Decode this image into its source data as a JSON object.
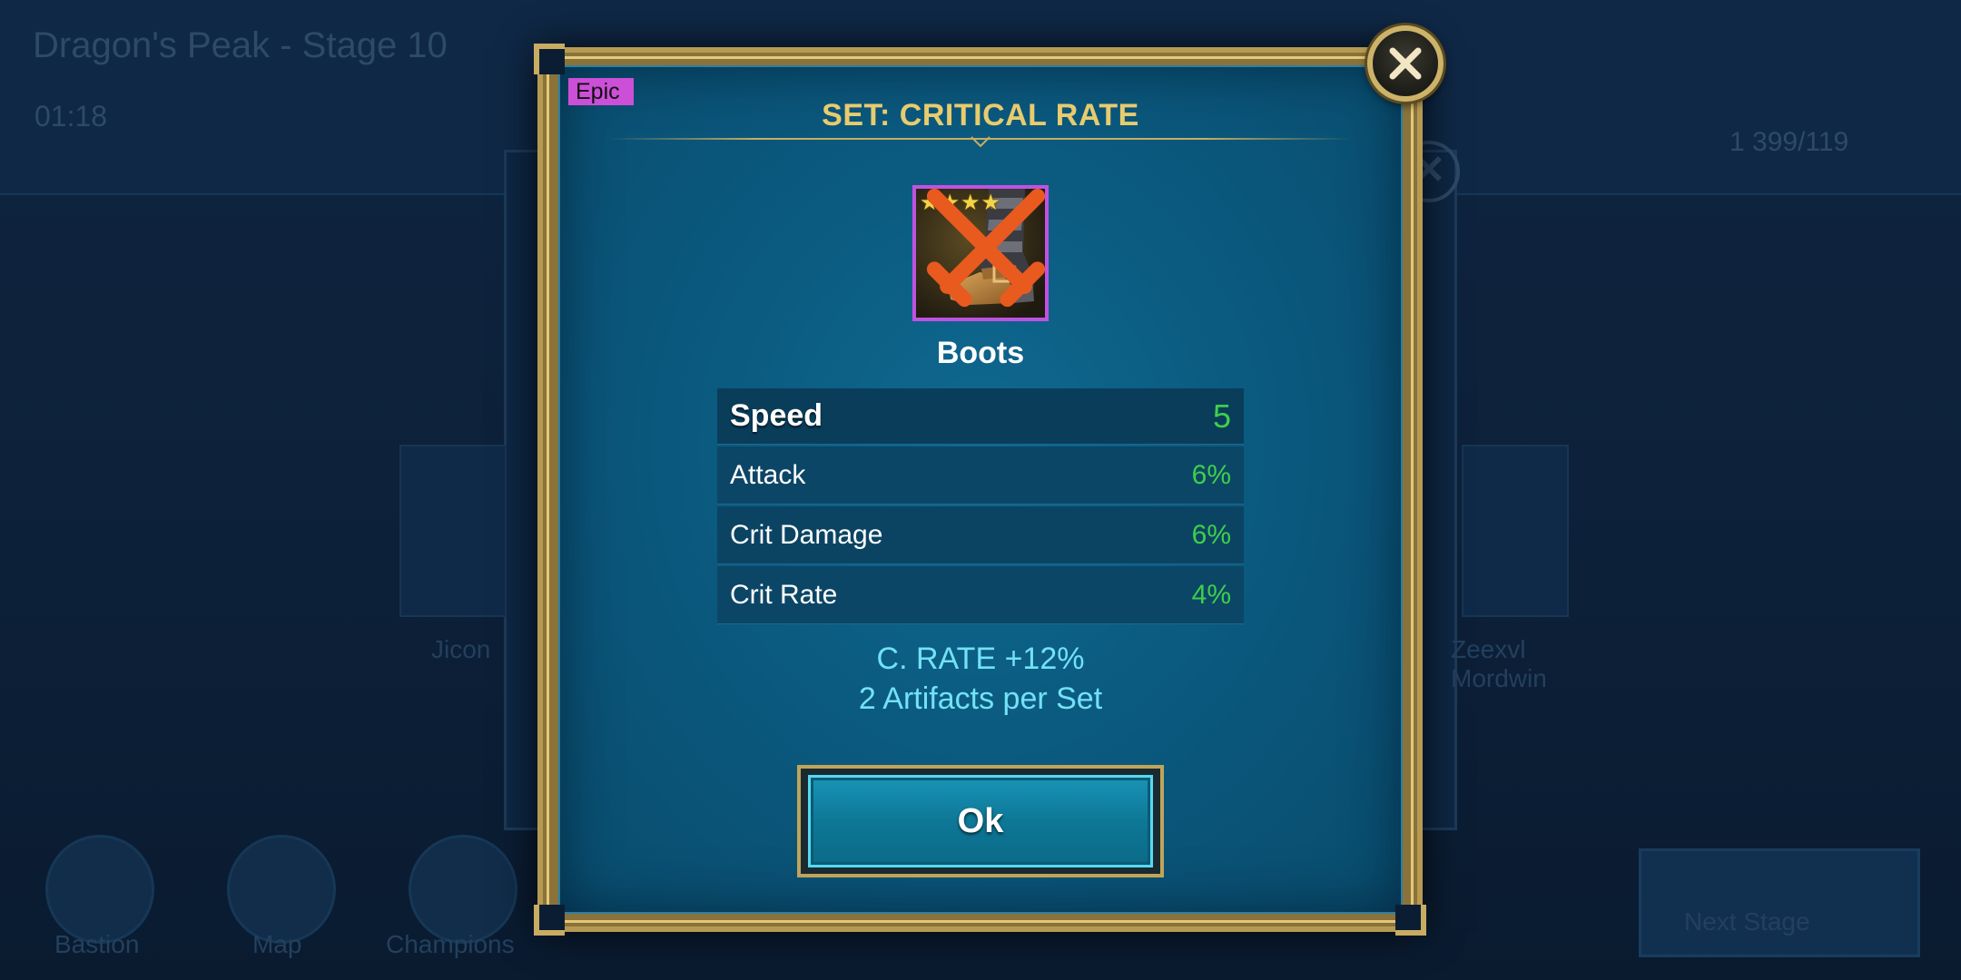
{
  "background": {
    "title": "Dragon's Peak - Stage 10",
    "timer": "01:18",
    "energy": "1 399/119",
    "slot_names": [
      "Jicon",
      "Zeexvl Mordwin"
    ],
    "nav": [
      {
        "label": "Bastion",
        "icon": "castle-icon"
      },
      {
        "label": "Map",
        "icon": "compass-icon"
      },
      {
        "label": "Champions",
        "icon": "helmet-icon"
      }
    ],
    "next_button_label": "Next Stage"
  },
  "modal": {
    "rarity": "Epic",
    "title": "SET: CRITICAL RATE",
    "item": {
      "name": "Boots",
      "stars": 4,
      "icon": "boots-icon",
      "faction_icon": "crossed-swords-icon"
    },
    "main_stat": {
      "label": "Speed",
      "value": "5"
    },
    "substats": [
      {
        "label": "Attack",
        "value": "6%"
      },
      {
        "label": "Crit Damage",
        "value": "6%"
      },
      {
        "label": "Crit Rate",
        "value": "4%"
      }
    ],
    "set_bonus": "C. RATE +12%",
    "set_requirement": "2 Artifacts per Set",
    "ok_label": "Ok",
    "colors": {
      "title": "#e8cb6e",
      "rarity_epic": "#cc4fd8",
      "stat_value": "#3fcf4a",
      "set_bonus": "#72e2f5",
      "frame_gold": "#c8ac62"
    }
  }
}
